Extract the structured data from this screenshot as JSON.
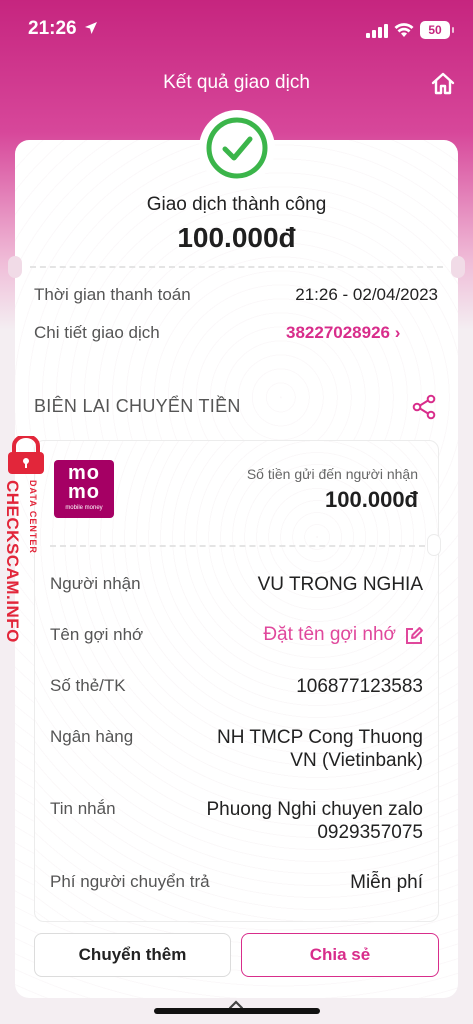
{
  "status_bar": {
    "time": "21:26",
    "battery": "50"
  },
  "header": {
    "title": "Kết quả giao dịch"
  },
  "result": {
    "status": "Giao dịch thành công",
    "amount": "100.000đ"
  },
  "info": {
    "time_label": "Thời gian thanh toán",
    "time_value": "21:26 - 02/04/2023",
    "detail_label": "Chi tiết giao dịch",
    "detail_value": "38227028926 ›"
  },
  "receipt": {
    "heading": "BIÊN LAI CHUYỂN TIỀN",
    "logo_top": "mo",
    "logo_bottom": "mo",
    "logo_sub": "mobile money",
    "sent_label": "Số tiền gửi đến người nhận",
    "sent_amount": "100.000đ",
    "rows": [
      {
        "label": "Người nhận",
        "value": "VU TRONG NGHIA"
      },
      {
        "label": "Tên gợi nhớ",
        "value": "Đặt tên gợi nhớ"
      },
      {
        "label": "Số thẻ/TK",
        "value": "106877123583"
      },
      {
        "label": "Ngân hàng",
        "value_line1": "NH TMCP Cong Thuong",
        "value_line2": "VN (Vietinbank)"
      },
      {
        "label": "Tin nhắn",
        "value_line1": "Phuong Nghi chuyen zalo",
        "value_line2": "0929357075"
      },
      {
        "label": "Phí người chuyển trả",
        "value": "Miễn phí"
      }
    ]
  },
  "buttons": {
    "more": "Chuyển thêm",
    "share": "Chia sẻ"
  },
  "watermark": {
    "site": "CHECKSCAM.INFO",
    "sub": "DATA CENTER"
  },
  "colors": {
    "brand": "#d82d8b",
    "momo": "#a50064",
    "success": "#3bb54a"
  }
}
